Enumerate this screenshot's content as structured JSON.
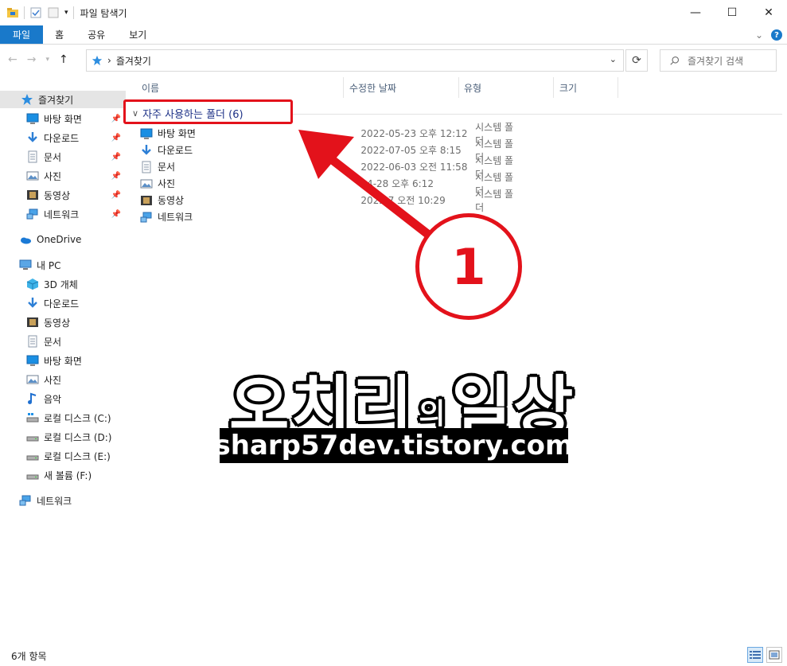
{
  "window": {
    "title": "파일 탐색기",
    "controls": {
      "minimize": "—",
      "maximize": "☐",
      "close": "✕"
    }
  },
  "ribbon": {
    "tabs": [
      "파일",
      "홈",
      "공유",
      "보기"
    ],
    "expand": "⌄",
    "help": "?"
  },
  "address": {
    "path": "즐겨찾기",
    "separator": "›",
    "search_placeholder": "즐겨찾기 검색"
  },
  "nav_pane": {
    "quick_access": "즐겨찾기",
    "pinned": [
      {
        "label": "바탕 화면",
        "icon": "desktop-icon"
      },
      {
        "label": "다운로드",
        "icon": "download-icon"
      },
      {
        "label": "문서",
        "icon": "document-icon"
      },
      {
        "label": "사진",
        "icon": "pictures-icon"
      },
      {
        "label": "동영상",
        "icon": "video-icon"
      },
      {
        "label": "네트워크",
        "icon": "network-icon"
      }
    ],
    "onedrive": "OneDrive",
    "this_pc": "내 PC",
    "pc_items": [
      {
        "label": "3D 개체",
        "icon": "3d-objects-icon"
      },
      {
        "label": "다운로드",
        "icon": "download-icon"
      },
      {
        "label": "동영상",
        "icon": "video-icon"
      },
      {
        "label": "문서",
        "icon": "document-icon"
      },
      {
        "label": "바탕 화면",
        "icon": "desktop-icon"
      },
      {
        "label": "사진",
        "icon": "pictures-icon"
      },
      {
        "label": "음악",
        "icon": "music-icon"
      },
      {
        "label": "로컬 디스크 (C:)",
        "icon": "system-drive-icon"
      },
      {
        "label": "로컬 디스크 (D:)",
        "icon": "drive-icon"
      },
      {
        "label": "로컬 디스크 (E:)",
        "icon": "drive-icon"
      },
      {
        "label": "새 볼륨 (F:)",
        "icon": "drive-icon"
      }
    ],
    "network": "네트워크"
  },
  "columns": [
    "이름",
    "수정한 날짜",
    "유형",
    "크기"
  ],
  "group": {
    "title": "자주 사용하는 폴더 (6)",
    "chevron": "∨"
  },
  "files": [
    {
      "name": "바탕 화면",
      "date": "2022-05-23 오후 12:12",
      "type": "시스템 폴더",
      "icon": "desktop-icon"
    },
    {
      "name": "다운로드",
      "date": "2022-07-05 오후 8:15",
      "type": "시스템 폴더",
      "icon": "download-icon"
    },
    {
      "name": "문서",
      "date": "2022-06-03 오전 11:58",
      "type": "시스템 폴더",
      "icon": "document-icon"
    },
    {
      "name": "사진",
      "date": "04-28 오후 6:12",
      "type": "시스템 폴더",
      "icon": "pictures-icon"
    },
    {
      "name": "동영상",
      "date": "2022 7 오전 10:29",
      "type": "시스템 폴더",
      "icon": "video-icon"
    },
    {
      "name": "네트워크",
      "date": "",
      "type": "",
      "icon": "network-icon"
    }
  ],
  "annotation": {
    "step_number": "1",
    "color": "#e3121b"
  },
  "watermark": {
    "title_a": "오치리",
    "title_small": "의",
    "title_b": "일상",
    "url": "sharp57dev.tistory.com"
  },
  "status": {
    "item_count": "6개 항목"
  },
  "colors": {
    "accent": "#1979ca",
    "selected_nav": "#e5e5e5",
    "group_text": "#1e3287"
  }
}
